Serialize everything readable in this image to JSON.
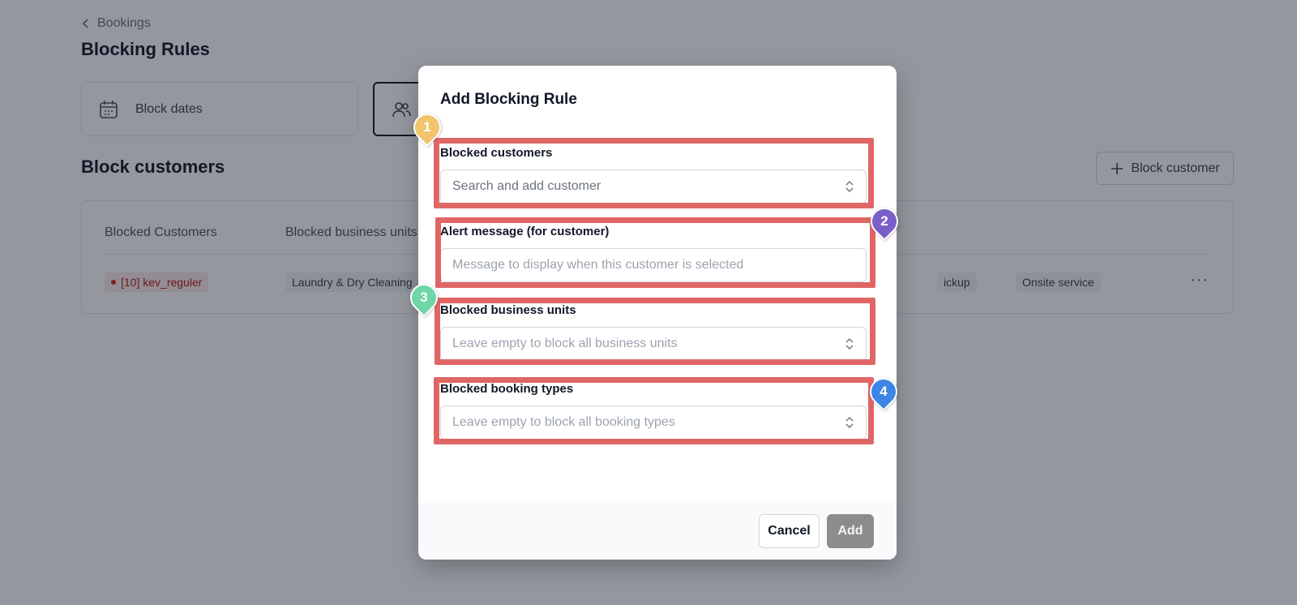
{
  "background": {
    "breadcrumb": "Bookings",
    "page_title": "Blocking Rules",
    "cards": {
      "block_dates": "Block dates"
    },
    "section_title": "Block customers",
    "block_customer_button": "Block customer",
    "table": {
      "headers": [
        "Blocked Customers",
        "Blocked business units"
      ],
      "row": {
        "customer": "[10] kev_reguler",
        "business_unit": "Laundry & Dry Cleaning",
        "booking_types": [
          "ickup",
          "Onsite service"
        ]
      },
      "row_menu": "···"
    }
  },
  "modal": {
    "title": "Add Blocking Rule",
    "fields": [
      {
        "label": "Blocked customers",
        "placeholder": "Search and add customer"
      },
      {
        "label": "Alert message (for customer)",
        "placeholder": "Message to display when this customer is selected"
      },
      {
        "label": "Blocked business units",
        "placeholder": "Leave empty to block all business units"
      },
      {
        "label": "Blocked booking types",
        "placeholder": "Leave empty to block all booking types"
      }
    ],
    "cancel_label": "Cancel",
    "add_label": "Add"
  },
  "markers": [
    {
      "number": "1",
      "color": "#f2c46d"
    },
    {
      "number": "2",
      "color": "#7a5fc9"
    },
    {
      "number": "3",
      "color": "#6fd6a8"
    },
    {
      "number": "4",
      "color": "#3d85e6"
    }
  ],
  "colors": {
    "highlight": "#e06666",
    "add_button": "#8c8c8c",
    "overlay": "rgba(17,24,39,0.45)"
  },
  "icons": [
    "chevron-left-icon",
    "calendar-icon",
    "users-icon",
    "plus-icon",
    "chevron-updown-icon"
  ]
}
